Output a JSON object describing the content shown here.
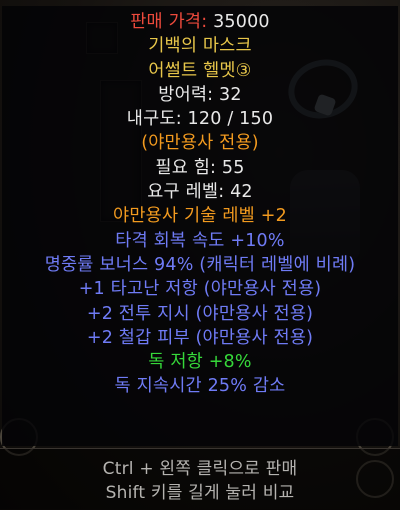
{
  "tooltip": {
    "price_label": "판매 가격:",
    "price_value": " 35000",
    "item_name": "기백의 마스크",
    "item_type": "어썰트 헬멧③",
    "defense": "방어력: 32",
    "durability": "내구도: 120 / 150",
    "class_only": "(야만용사 전용)",
    "req_str": "필요 힘: 55",
    "req_level": "요구 레벨: 42",
    "mods": [
      "야만용사 기술 레벨 +2",
      "타격 회복 속도 +10%",
      "명중률 보너스 94% (캐릭터 레벨에 비례)",
      "+1 타고난 저항 (야만용사 전용)",
      "+2 전투 지시 (야만용사 전용)",
      "+2 철갑 피부 (야만용사 전용)",
      "독 저항 +8%",
      "독 지속시간 25% 감소"
    ]
  },
  "hint": {
    "line1": "Ctrl + 왼쪽 클릭으로 판매",
    "line2": "Shift 키를 길게 눌러 비교"
  },
  "colors": {
    "price_label": "#ec4a3c",
    "unique_gold": "#e7c64a",
    "class_orange": "#f29a1f",
    "magic_blue": "#6f7bf5",
    "resist_green": "#36d83a"
  }
}
